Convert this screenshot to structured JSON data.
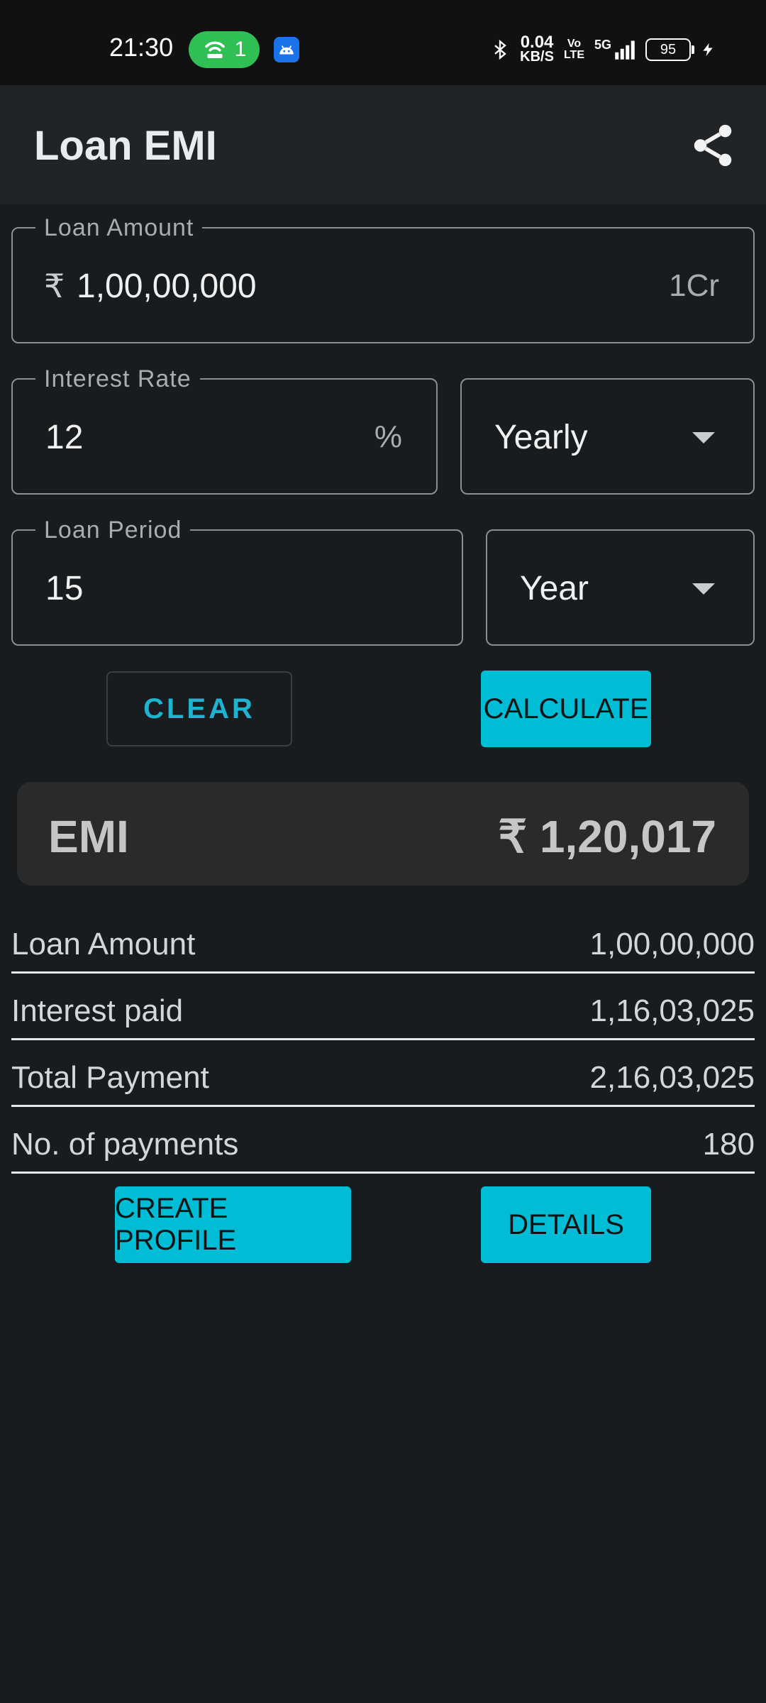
{
  "status_bar": {
    "time": "21:30",
    "hotspot_count": "1",
    "speed_value": "0.04",
    "speed_unit": "KB/S",
    "volte_top": "Vo",
    "volte_bottom": "LTE",
    "network": "5G",
    "battery": "95"
  },
  "app_bar": {
    "title": "Loan EMI",
    "share_icon": "share-icon"
  },
  "form": {
    "loan_amount": {
      "label": "Loan Amount",
      "prefix": "₹",
      "value": "1,00,00,000",
      "suffix": "1Cr"
    },
    "interest_rate": {
      "label": "Interest Rate",
      "value": "12",
      "suffix": "%"
    },
    "interest_period": {
      "selected": "Yearly"
    },
    "loan_period": {
      "label": "Loan Period",
      "value": "15"
    },
    "period_unit": {
      "selected": "Year"
    }
  },
  "actions": {
    "clear_label": "CLEAR",
    "calculate_label": "CALCULATE"
  },
  "result": {
    "emi_label": "EMI",
    "emi_value": "₹ 1,20,017"
  },
  "summary": {
    "rows": [
      {
        "label": "Loan Amount",
        "value": "1,00,00,000"
      },
      {
        "label": "Interest paid",
        "value": "1,16,03,025"
      },
      {
        "label": "Total Payment",
        "value": "2,16,03,025"
      },
      {
        "label": "No. of payments",
        "value": "180"
      }
    ]
  },
  "footer_actions": {
    "create_profile_label": "CREATE PROFILE",
    "details_label": "DETAILS"
  },
  "colors": {
    "background": "#181c1e",
    "app_bar": "#202426",
    "accent": "#00bcd4",
    "status_pill": "#2fbf55"
  }
}
